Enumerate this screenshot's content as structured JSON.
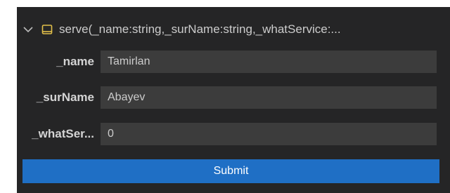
{
  "function": {
    "icon": "method-icon",
    "expanded_icon": "chevron-down-icon",
    "signature": "serve(_name:string,_surName:string,_whatService:..."
  },
  "params": [
    {
      "label": "_name",
      "value": "Tamirlan"
    },
    {
      "label": "_surName",
      "value": "Abayev"
    },
    {
      "label": "_whatSer...",
      "value": "0"
    }
  ],
  "submit_label": "Submit",
  "colors": {
    "panel_bg": "#252526",
    "input_bg": "#3c3c3c",
    "accent": "#1f6fc5",
    "icon_yellow": "#e2c04a"
  }
}
